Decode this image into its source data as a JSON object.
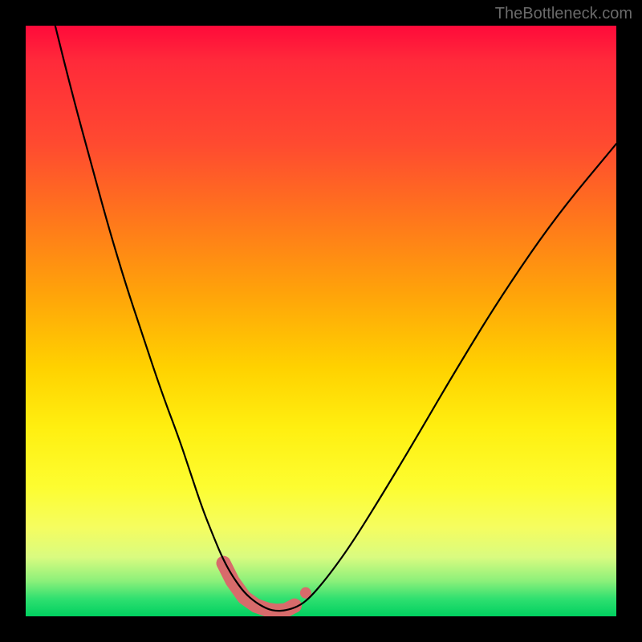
{
  "watermark": "TheBottleneck.com",
  "chart_data": {
    "type": "line",
    "title": "",
    "xlabel": "",
    "ylabel": "",
    "xlim": [
      0,
      100
    ],
    "ylim": [
      0,
      100
    ],
    "grid": false,
    "series": [
      {
        "name": "main-curve",
        "x": [
          5,
          8,
          11,
          14,
          17,
          20,
          23,
          26,
          28,
          30,
          32,
          33.5,
          35,
          37,
          39,
          41,
          42.5,
          44,
          46,
          48,
          51,
          55,
          60,
          66,
          73,
          81,
          90,
          100
        ],
        "values": [
          100,
          88,
          77,
          66,
          56,
          47,
          38,
          30,
          24,
          18,
          13,
          9.5,
          6.8,
          4.0,
          2.3,
          1.2,
          0.9,
          1.0,
          1.6,
          3.0,
          6.5,
          12,
          20,
          30,
          42,
          55,
          68,
          80
        ]
      },
      {
        "name": "minimum-band",
        "x": [
          33.5,
          35,
          37,
          39,
          41,
          42.5,
          44,
          45.5
        ],
        "values": [
          9.0,
          6.0,
          3.2,
          1.8,
          1.1,
          0.9,
          1.0,
          1.8
        ]
      }
    ],
    "gradient_stops": [
      {
        "pos": 0.0,
        "color": "#ff0a3a"
      },
      {
        "pos": 0.2,
        "color": "#ff4a30"
      },
      {
        "pos": 0.45,
        "color": "#ffa20a"
      },
      {
        "pos": 0.68,
        "color": "#ffef10"
      },
      {
        "pos": 0.9,
        "color": "#d9fb80"
      },
      {
        "pos": 1.0,
        "color": "#00d060"
      }
    ]
  }
}
